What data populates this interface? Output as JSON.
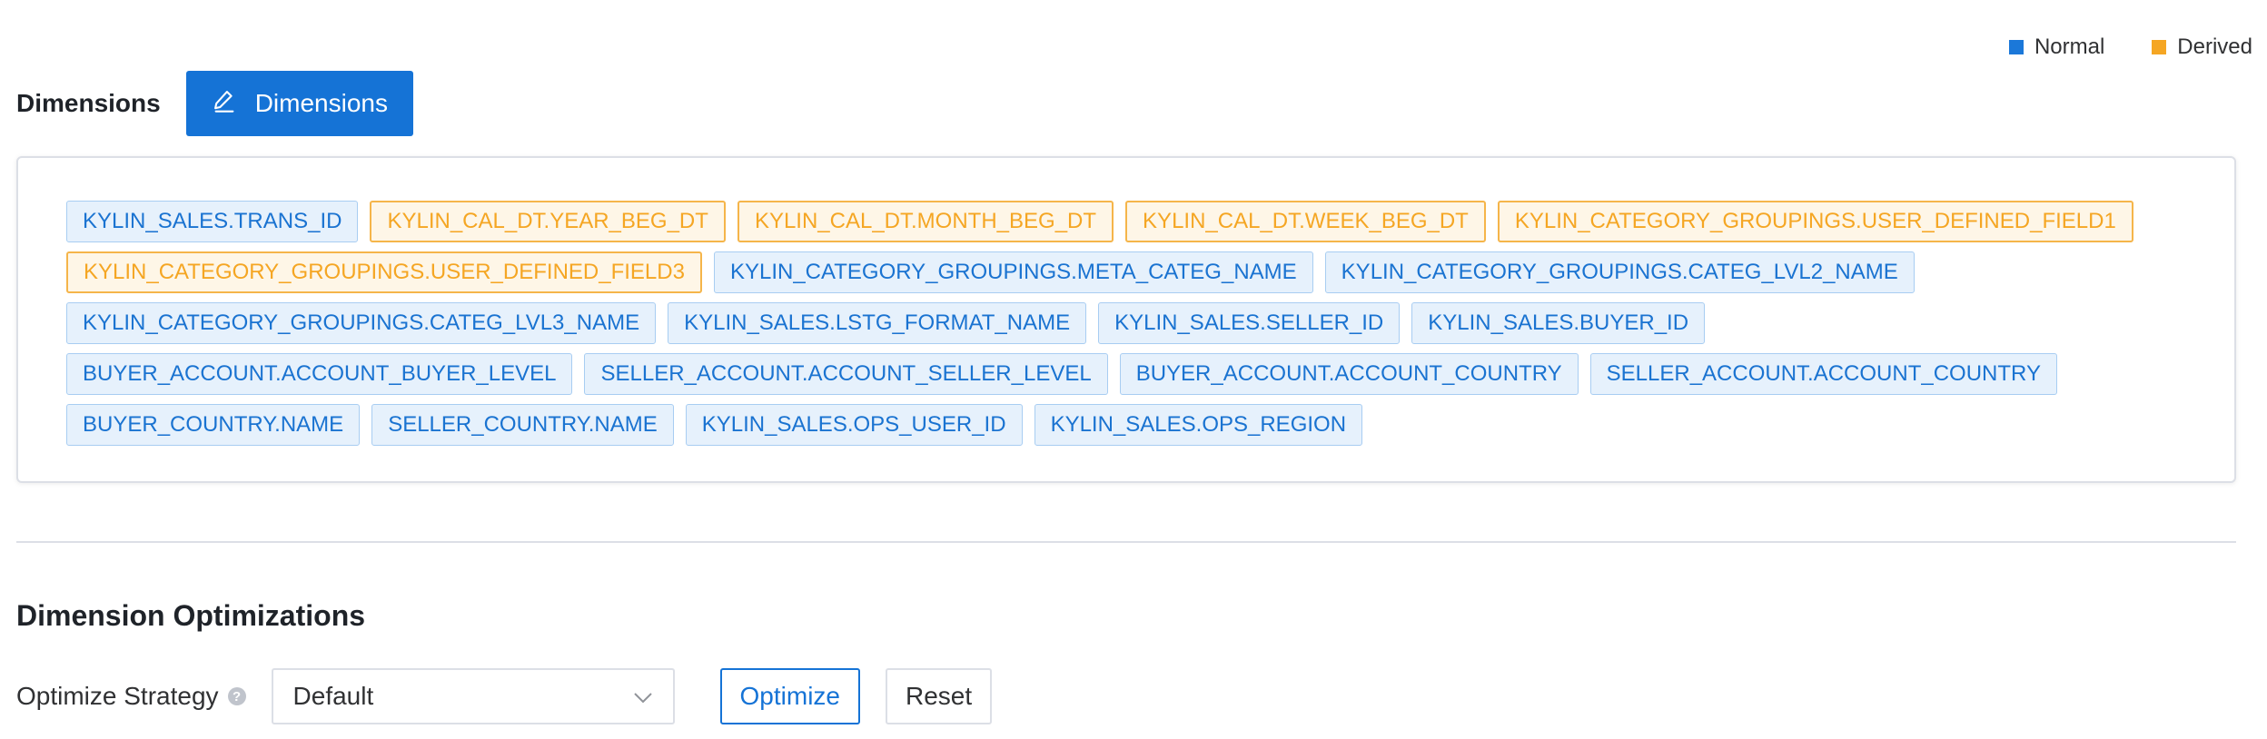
{
  "legend": {
    "normal": {
      "label": "Normal",
      "color": "#1b78d9"
    },
    "derived": {
      "label": "Derived",
      "color": "#f5a623"
    }
  },
  "dimensions": {
    "title": "Dimensions",
    "edit_button_label": "Dimensions",
    "edit_button_icon": "edit-pencil-icon",
    "items": [
      {
        "label": "KYLIN_SALES.TRANS_ID",
        "type": "normal"
      },
      {
        "label": "KYLIN_CAL_DT.YEAR_BEG_DT",
        "type": "derived"
      },
      {
        "label": "KYLIN_CAL_DT.MONTH_BEG_DT",
        "type": "derived"
      },
      {
        "label": "KYLIN_CAL_DT.WEEK_BEG_DT",
        "type": "derived"
      },
      {
        "label": "KYLIN_CATEGORY_GROUPINGS.USER_DEFINED_FIELD1",
        "type": "derived"
      },
      {
        "label": "KYLIN_CATEGORY_GROUPINGS.USER_DEFINED_FIELD3",
        "type": "derived"
      },
      {
        "label": "KYLIN_CATEGORY_GROUPINGS.META_CATEG_NAME",
        "type": "normal"
      },
      {
        "label": "KYLIN_CATEGORY_GROUPINGS.CATEG_LVL2_NAME",
        "type": "normal"
      },
      {
        "label": "KYLIN_CATEGORY_GROUPINGS.CATEG_LVL3_NAME",
        "type": "normal"
      },
      {
        "label": "KYLIN_SALES.LSTG_FORMAT_NAME",
        "type": "normal"
      },
      {
        "label": "KYLIN_SALES.SELLER_ID",
        "type": "normal"
      },
      {
        "label": "KYLIN_SALES.BUYER_ID",
        "type": "normal"
      },
      {
        "label": "BUYER_ACCOUNT.ACCOUNT_BUYER_LEVEL",
        "type": "normal"
      },
      {
        "label": "SELLER_ACCOUNT.ACCOUNT_SELLER_LEVEL",
        "type": "normal"
      },
      {
        "label": "BUYER_ACCOUNT.ACCOUNT_COUNTRY",
        "type": "normal"
      },
      {
        "label": "SELLER_ACCOUNT.ACCOUNT_COUNTRY",
        "type": "normal"
      },
      {
        "label": "BUYER_COUNTRY.NAME",
        "type": "normal"
      },
      {
        "label": "SELLER_COUNTRY.NAME",
        "type": "normal"
      },
      {
        "label": "KYLIN_SALES.OPS_USER_ID",
        "type": "normal"
      },
      {
        "label": "KYLIN_SALES.OPS_REGION",
        "type": "normal"
      }
    ]
  },
  "optimizations": {
    "title": "Dimension Optimizations",
    "strategy_label": "Optimize Strategy",
    "help_icon": "question-circle-icon",
    "strategy_value": "Default",
    "optimize_label": "Optimize",
    "reset_label": "Reset"
  }
}
